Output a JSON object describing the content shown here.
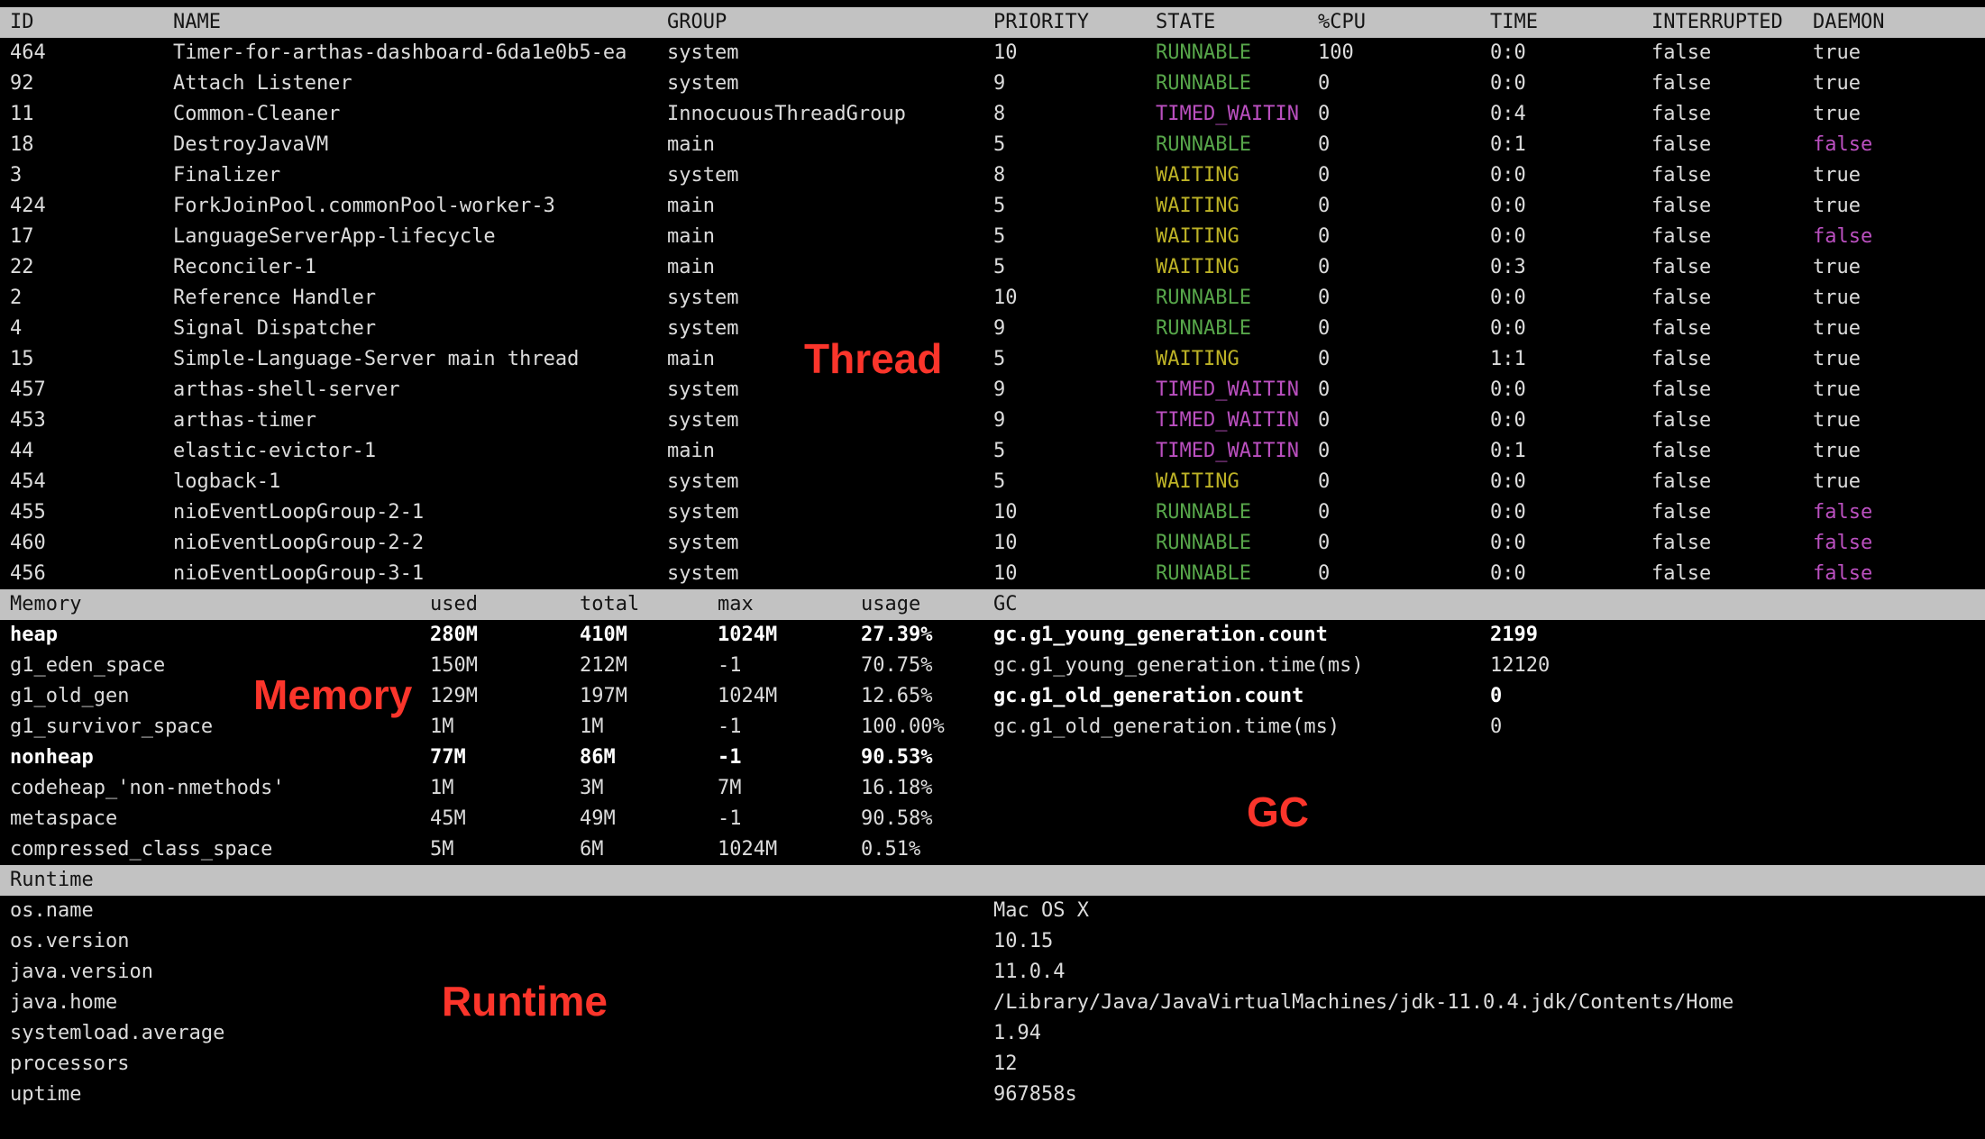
{
  "colors": {
    "background": "#000000",
    "header_bar": "#c2c2c2",
    "header_bar_text": "#141414",
    "text": "#dcdcdc",
    "bold_text": "#ffffff",
    "state_runnable": "#57a64a",
    "state_waiting": "#bdb226",
    "state_timed_waiting": "#bb50c0",
    "daemon_false": "#bb50c0",
    "annotation_red": "#fb352b"
  },
  "annotations": {
    "thread": "Thread",
    "memory": "Memory",
    "gc": "GC",
    "runtime": "Runtime"
  },
  "thread_table": {
    "headers": [
      "ID",
      "NAME",
      "GROUP",
      "PRIORITY",
      "STATE",
      "%CPU",
      "TIME",
      "INTERRUPTED",
      "DAEMON"
    ],
    "rows": [
      [
        "464",
        "Timer-for-arthas-dashboard-6da1e0b5-ea",
        "system",
        "10",
        "RUNNABLE",
        "100",
        "0:0",
        "false",
        "true"
      ],
      [
        "92",
        "Attach Listener",
        "system",
        "9",
        "RUNNABLE",
        "0",
        "0:0",
        "false",
        "true"
      ],
      [
        "11",
        "Common-Cleaner",
        "InnocuousThreadGroup",
        "8",
        "TIMED_WAITIN",
        "0",
        "0:4",
        "false",
        "true"
      ],
      [
        "18",
        "DestroyJavaVM",
        "main",
        "5",
        "RUNNABLE",
        "0",
        "0:1",
        "false",
        "false"
      ],
      [
        "3",
        "Finalizer",
        "system",
        "8",
        "WAITING",
        "0",
        "0:0",
        "false",
        "true"
      ],
      [
        "424",
        "ForkJoinPool.commonPool-worker-3",
        "main",
        "5",
        "WAITING",
        "0",
        "0:0",
        "false",
        "true"
      ],
      [
        "17",
        "LanguageServerApp-lifecycle",
        "main",
        "5",
        "WAITING",
        "0",
        "0:0",
        "false",
        "false"
      ],
      [
        "22",
        "Reconciler-1",
        "main",
        "5",
        "WAITING",
        "0",
        "0:3",
        "false",
        "true"
      ],
      [
        "2",
        "Reference Handler",
        "system",
        "10",
        "RUNNABLE",
        "0",
        "0:0",
        "false",
        "true"
      ],
      [
        "4",
        "Signal Dispatcher",
        "system",
        "9",
        "RUNNABLE",
        "0",
        "0:0",
        "false",
        "true"
      ],
      [
        "15",
        "Simple-Language-Server main thread",
        "main",
        "5",
        "WAITING",
        "0",
        "1:1",
        "false",
        "true"
      ],
      [
        "457",
        "arthas-shell-server",
        "system",
        "9",
        "TIMED_WAITIN",
        "0",
        "0:0",
        "false",
        "true"
      ],
      [
        "453",
        "arthas-timer",
        "system",
        "9",
        "TIMED_WAITIN",
        "0",
        "0:0",
        "false",
        "true"
      ],
      [
        "44",
        "elastic-evictor-1",
        "main",
        "5",
        "TIMED_WAITIN",
        "0",
        "0:1",
        "false",
        "true"
      ],
      [
        "454",
        "logback-1",
        "system",
        "5",
        "WAITING",
        "0",
        "0:0",
        "false",
        "true"
      ],
      [
        "455",
        "nioEventLoopGroup-2-1",
        "system",
        "10",
        "RUNNABLE",
        "0",
        "0:0",
        "false",
        "false"
      ],
      [
        "460",
        "nioEventLoopGroup-2-2",
        "system",
        "10",
        "RUNNABLE",
        "0",
        "0:0",
        "false",
        "false"
      ],
      [
        "456",
        "nioEventLoopGroup-3-1",
        "system",
        "10",
        "RUNNABLE",
        "0",
        "0:0",
        "false",
        "false"
      ]
    ]
  },
  "memory_table": {
    "headers": [
      "Memory",
      "used",
      "total",
      "max",
      "usage",
      "GC"
    ],
    "rows": [
      {
        "cells": [
          "heap",
          "280M",
          "410M",
          "1024M",
          "27.39%"
        ],
        "bold": true
      },
      {
        "cells": [
          "g1_eden_space",
          "150M",
          "212M",
          "-1",
          "70.75%"
        ],
        "bold": false
      },
      {
        "cells": [
          "g1_old_gen",
          "129M",
          "197M",
          "1024M",
          "12.65%"
        ],
        "bold": false
      },
      {
        "cells": [
          "g1_survivor_space",
          "1M",
          "1M",
          "-1",
          "100.00%"
        ],
        "bold": false
      },
      {
        "cells": [
          "nonheap",
          "77M",
          "86M",
          "-1",
          "90.53%"
        ],
        "bold": true
      },
      {
        "cells": [
          "codeheap_'non-nmethods'",
          "1M",
          "3M",
          "7M",
          "16.18%"
        ],
        "bold": false
      },
      {
        "cells": [
          "metaspace",
          "45M",
          "49M",
          "-1",
          "90.58%"
        ],
        "bold": false
      },
      {
        "cells": [
          "compressed_class_space",
          "5M",
          "6M",
          "1024M",
          "0.51%"
        ],
        "bold": false
      }
    ],
    "gc_rows": [
      {
        "label": "gc.g1_young_generation.count",
        "value": "2199",
        "bold": true
      },
      {
        "label": "gc.g1_young_generation.time(ms)",
        "value": "12120",
        "bold": false
      },
      {
        "label": "gc.g1_old_generation.count",
        "value": "0",
        "bold": true
      },
      {
        "label": "gc.g1_old_generation.time(ms)",
        "value": "0",
        "bold": false
      }
    ]
  },
  "runtime": {
    "header": "Runtime",
    "rows": [
      {
        "key": "os.name",
        "value": "Mac OS X"
      },
      {
        "key": "os.version",
        "value": "10.15"
      },
      {
        "key": "java.version",
        "value": "11.0.4"
      },
      {
        "key": "java.home",
        "value": "/Library/Java/JavaVirtualMachines/jdk-11.0.4.jdk/Contents/Home"
      },
      {
        "key": "systemload.average",
        "value": "1.94"
      },
      {
        "key": "processors",
        "value": "12"
      },
      {
        "key": "uptime",
        "value": "967858s"
      }
    ]
  }
}
